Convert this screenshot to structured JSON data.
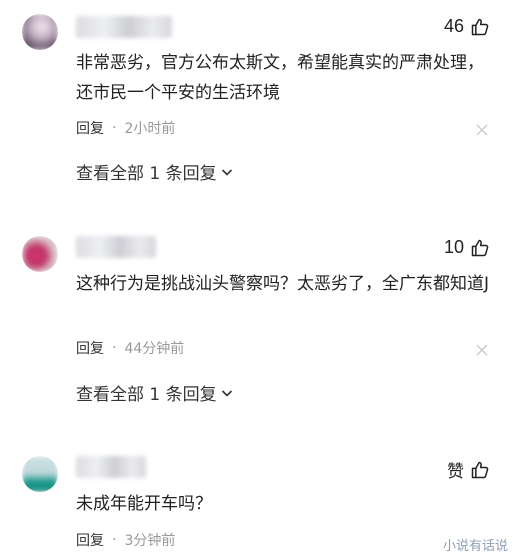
{
  "comments": [
    {
      "likes": "46",
      "text": "非常恶劣，官方公布太斯文，希望能真实的严肃处理，还市民一个平安的生活环境",
      "reply_label": "回复",
      "separator": "·",
      "time": "2小时前",
      "view_all": "查看全部 1 条回复"
    },
    {
      "likes": "10",
      "text": "这种行为是挑战汕头警察吗？太恶劣了，全广东都知道J",
      "reply_label": "回复",
      "separator": "·",
      "time": "44分钟前",
      "view_all": "查看全部 1 条回复"
    },
    {
      "likes": "赞",
      "text": "未成年能开车吗？",
      "reply_label": "回复",
      "separator": "·",
      "time": "3分钟前"
    }
  ],
  "watermark": "小说有话说",
  "icons": {
    "like": "thumbs-up-icon",
    "close": "close-icon",
    "expand": "chevron-down-icon"
  },
  "colors": {
    "text": "#222222",
    "muted": "#999999",
    "watermark": "#7a8ea8"
  }
}
